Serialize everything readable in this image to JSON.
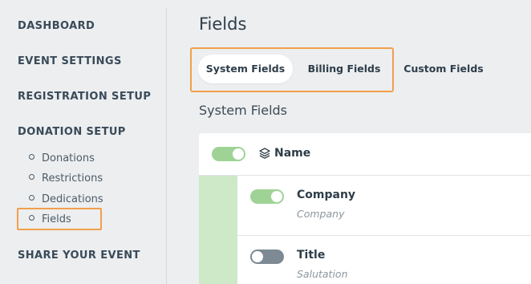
{
  "sidebar": {
    "sections": {
      "dashboard": "DASHBOARD",
      "event_settings": "EVENT SETTINGS",
      "registration_setup": "REGISTRATION SETUP",
      "donation_setup": "DONATION SETUP",
      "share_your_event": "SHARE YOUR EVENT"
    },
    "donation_items": [
      "Donations",
      "Restrictions",
      "Dedications",
      "Fields"
    ]
  },
  "main": {
    "title": "Fields",
    "tabs": [
      "System Fields",
      "Billing Fields",
      "Custom Fields"
    ],
    "active_tab": "System Fields",
    "section_title": "System Fields",
    "fields": [
      {
        "name": "Name",
        "subtitle": "",
        "enabled": true,
        "icon": "layers-icon"
      },
      {
        "name": "Company",
        "subtitle": "Company",
        "enabled": true
      },
      {
        "name": "Title",
        "subtitle": "Salutation",
        "enabled": false
      }
    ]
  },
  "colors": {
    "highlight": "#f0a04b",
    "toggle_on": "#9fd396",
    "toggle_off": "#7d8a93",
    "group_stripe": "#cde9c8"
  }
}
